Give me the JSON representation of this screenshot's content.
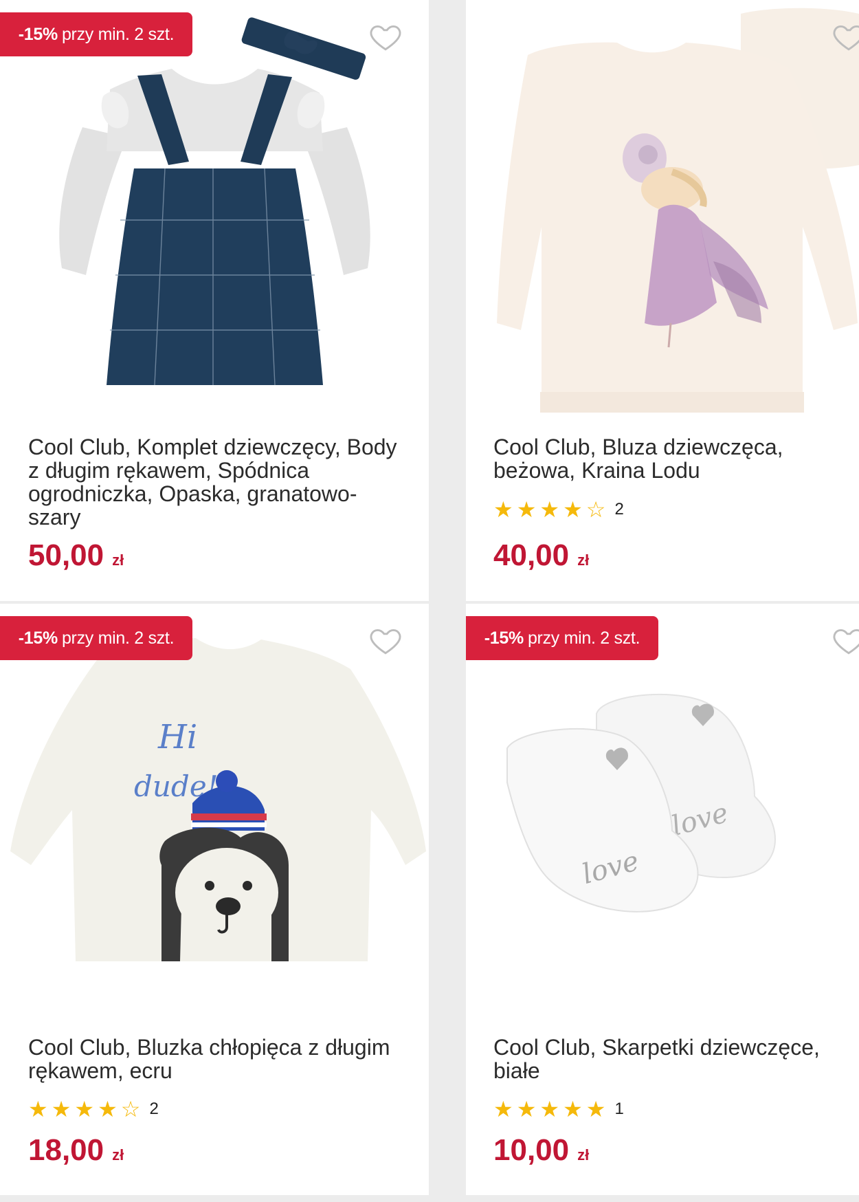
{
  "colors": {
    "accent": "#d8213c",
    "price": "#c01634",
    "star": "#f5b90b"
  },
  "products": [
    {
      "badge_pct": "-15%",
      "badge_text": "przy min. 2 szt.",
      "title": "Cool Club, Komplet dziewczęcy, Body z długim rękawem, Spódnica ogrodniczka, Opaska, granatowo-szary",
      "price": "50,00",
      "currency": "zł",
      "stars": 0,
      "reviews": "",
      "image": "navy checked pinafore dress with grey bodysuit and headband"
    },
    {
      "badge_pct": "",
      "badge_text": "",
      "title": "Cool Club, Bluza dziewczęca, beżowa, Kraina Lodu",
      "price": "40,00",
      "currency": "zł",
      "stars": 4,
      "reviews": "2",
      "image": "cream sweatshirt with Elsa print"
    },
    {
      "badge_pct": "-15%",
      "badge_text": "przy min. 2 szt.",
      "title": "Cool Club, Bluzka chłopięca z długim rękawem, ecru",
      "price": "18,00",
      "currency": "zł",
      "stars": 4,
      "reviews": "2",
      "image": "ecru long sleeve top with polar bear in blue hat"
    },
    {
      "badge_pct": "-15%",
      "badge_text": "przy min. 2 szt.",
      "title": "Cool Club, Skarpetki dziewczęce, białe",
      "price": "10,00",
      "currency": "zł",
      "stars": 5,
      "reviews": "1",
      "image": "white baby booties with grey hearts"
    }
  ]
}
